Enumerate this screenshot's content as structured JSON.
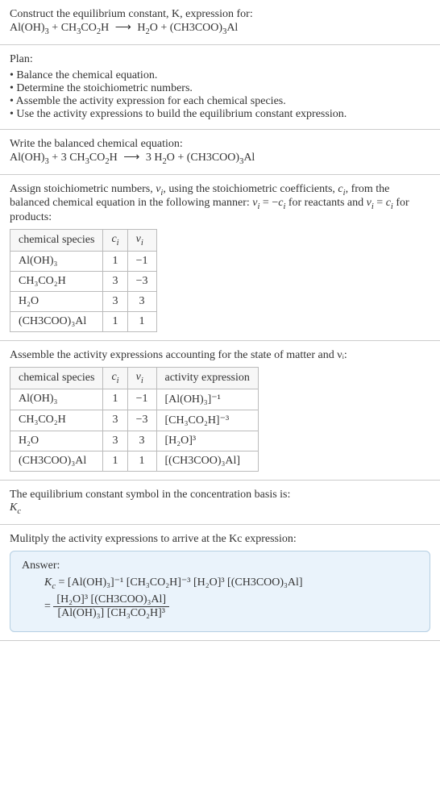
{
  "prompt": {
    "line1": "Construct the equilibrium constant, K, expression for:",
    "equation_lhs1": "Al(OH)",
    "equation_lhs1_sub": "3",
    "plus": " + ",
    "equation_lhs2": "CH",
    "equation_lhs2_sub1": "3",
    "equation_lhs2_mid": "CO",
    "equation_lhs2_sub2": "2",
    "equation_lhs2_end": "H",
    "arrow": "⟶",
    "equation_rhs1": "H",
    "equation_rhs1_sub": "2",
    "equation_rhs1_end": "O",
    "equation_rhs2": "(CH3COO)",
    "equation_rhs2_sub": "3",
    "equation_rhs2_end": "Al"
  },
  "plan": {
    "title": "Plan:",
    "items": [
      "Balance the chemical equation.",
      "Determine the stoichiometric numbers.",
      "Assemble the activity expression for each chemical species.",
      "Use the activity expressions to build the equilibrium constant expression."
    ]
  },
  "balanced": {
    "title": "Write the balanced chemical equation:",
    "c1": "Al(OH)",
    "c1s": "3",
    "c2a": "3 CH",
    "c2s1": "3",
    "c2b": "CO",
    "c2s2": "2",
    "c2c": "H",
    "arrow": "⟶",
    "c3a": "3 H",
    "c3s": "2",
    "c3b": "O",
    "c4a": "(CH3COO)",
    "c4s": "3",
    "c4b": "Al"
  },
  "stoich": {
    "intro1": "Assign stoichiometric numbers, ",
    "nu": "ν",
    "sub_i": "i",
    "intro2": ", using the stoichiometric coefficients, ",
    "c": "c",
    "intro3": ", from the balanced chemical equation in the following manner: ",
    "rule1a": "ν",
    "rule1b": " = −",
    "rule1c": "c",
    "rule1d": " for reactants and ",
    "rule2a": "ν",
    "rule2b": " = ",
    "rule2c": "c",
    "rule2d": " for products:",
    "headers": [
      "chemical species",
      "cᵢ",
      "νᵢ"
    ],
    "rows": [
      {
        "sp": "Al(OH)₃",
        "c": "1",
        "n": "−1"
      },
      {
        "sp": "CH₃CO₂H",
        "c": "3",
        "n": "−3"
      },
      {
        "sp": "H₂O",
        "c": "3",
        "n": "3"
      },
      {
        "sp": "(CH3COO)₃Al",
        "c": "1",
        "n": "1"
      }
    ]
  },
  "activity": {
    "intro": "Assemble the activity expressions accounting for the state of matter and νᵢ:",
    "headers": [
      "chemical species",
      "cᵢ",
      "νᵢ",
      "activity expression"
    ],
    "rows": [
      {
        "sp": "Al(OH)₃",
        "c": "1",
        "n": "−1",
        "a": "[Al(OH)₃]⁻¹"
      },
      {
        "sp": "CH₃CO₂H",
        "c": "3",
        "n": "−3",
        "a": "[CH₃CO₂H]⁻³"
      },
      {
        "sp": "H₂O",
        "c": "3",
        "n": "3",
        "a": "[H₂O]³"
      },
      {
        "sp": "(CH3COO)₃Al",
        "c": "1",
        "n": "1",
        "a": "[(CH3COO)₃Al]"
      }
    ]
  },
  "symbol": {
    "line1": "The equilibrium constant symbol in the concentration basis is:",
    "kc": "K",
    "kcsub": "c"
  },
  "multiply": {
    "line": "Mulitply the activity expressions to arrive at the Kc expression:"
  },
  "answer": {
    "label": "Answer:",
    "kc": "K",
    "kcsub": "c",
    "eq": " = ",
    "flat": "[Al(OH)₃]⁻¹ [CH₃CO₂H]⁻³ [H₂O]³ [(CH3COO)₃Al]",
    "num": "[H₂O]³ [(CH3COO)₃Al]",
    "den": "[Al(OH)₃] [CH₃CO₂H]³"
  }
}
